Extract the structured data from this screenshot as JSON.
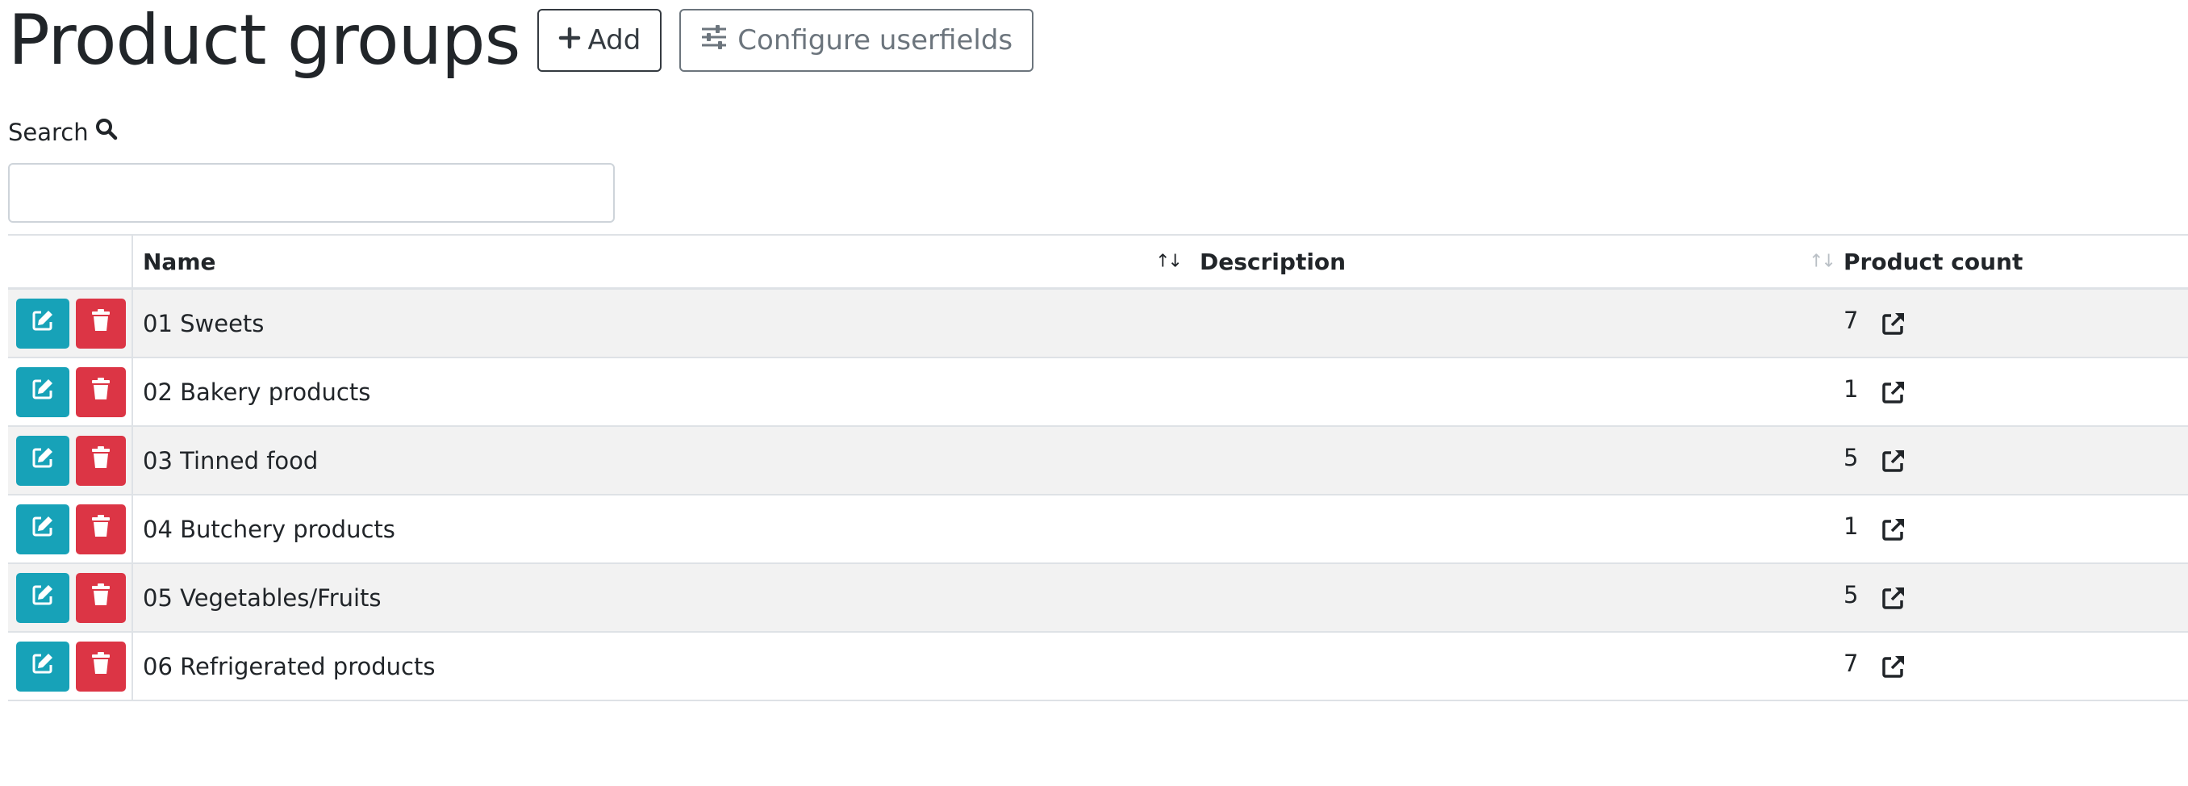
{
  "page": {
    "title": "Product groups",
    "add_label": "Add",
    "configure_label": "Configure userfields"
  },
  "search": {
    "label": "Search",
    "value": ""
  },
  "table": {
    "columns": {
      "name": "Name",
      "description": "Description",
      "product_count": "Product count"
    },
    "rows": [
      {
        "name": "01 Sweets",
        "description": "",
        "product_count": "7"
      },
      {
        "name": "02 Bakery products",
        "description": "",
        "product_count": "1"
      },
      {
        "name": "03 Tinned food",
        "description": "",
        "product_count": "5"
      },
      {
        "name": "04 Butchery products",
        "description": "",
        "product_count": "1"
      },
      {
        "name": "05 Vegetables/Fruits",
        "description": "",
        "product_count": "5"
      },
      {
        "name": "06 Refrigerated products",
        "description": "",
        "product_count": "7"
      }
    ]
  },
  "colors": {
    "edit_button": "#17a2b8",
    "delete_button": "#dc3545",
    "stripe": "#f2f2f2"
  },
  "icons": {
    "add": "plus-icon",
    "configure": "sliders-icon",
    "search": "search-icon",
    "edit": "edit-icon",
    "delete": "trash-icon",
    "open": "external-link-icon",
    "sort": "sort-icon"
  }
}
